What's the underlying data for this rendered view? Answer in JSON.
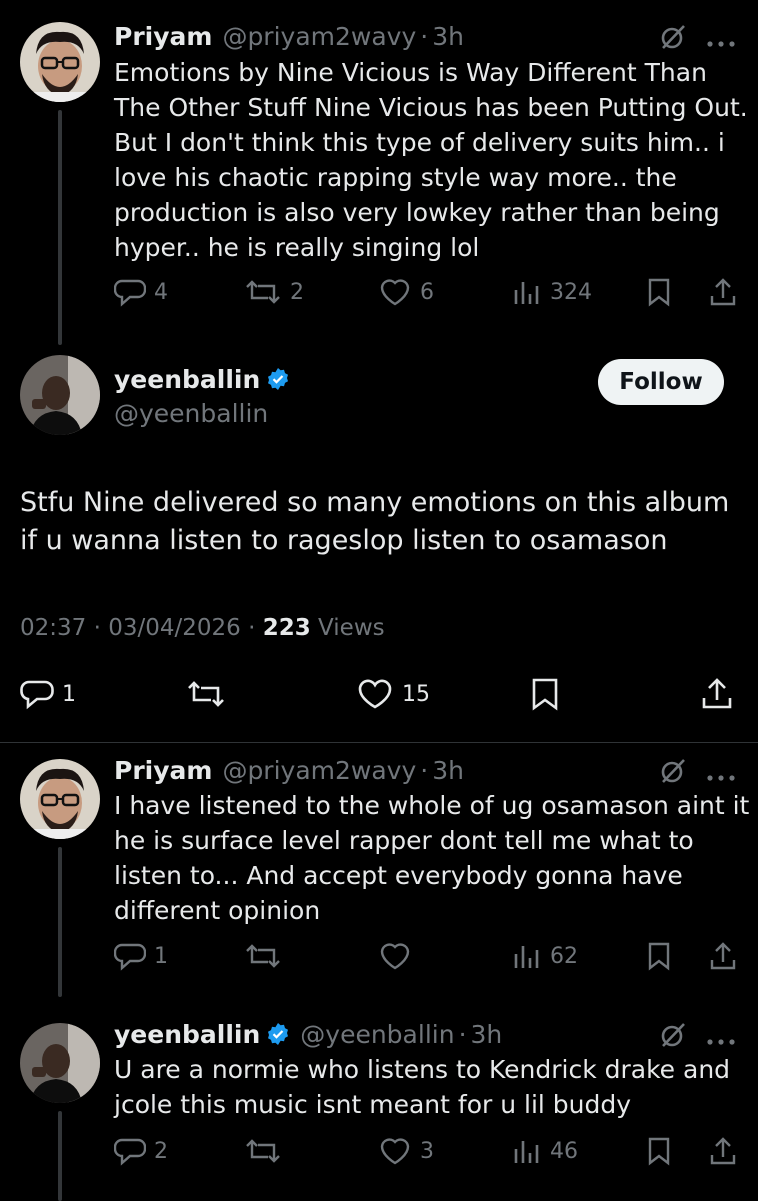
{
  "tweets": [
    {
      "name": "Priyam",
      "handle": "@priyam2wavy",
      "time": "3h",
      "text": "Emotions by Nine Vicious is Way Different Than\nThe Other Stuff Nine Vicious has been Putting Out.\nBut I don't think this type of delivery suits him.. i\nlove his chaotic rapping style way more.. the\nproduction is also very lowkey rather than being\nhyper.. he is really singing lol",
      "replies": "4",
      "reposts": "2",
      "likes": "6",
      "views": "324"
    },
    {
      "name": "yeenballin",
      "handle": "@yeenballin",
      "follow_label": "Follow",
      "text": "Stfu Nine delivered so many emotions on this album\nif u wanna listen to rageslop listen to osamason",
      "timestamp": "02:37 · 03/04/2026 · ",
      "views_count": "223",
      "views_label": " Views",
      "replies": "1",
      "likes": "15"
    },
    {
      "name": "Priyam",
      "handle": "@priyam2wavy",
      "time": "3h",
      "text": "I have listened to the whole of ug osamason aint it\nhe is  surface level rapper dont tell me what to\nlisten to... And accept everybody gonna have\ndifferent opinion",
      "replies": "1",
      "views": "62"
    },
    {
      "name": "yeenballin",
      "handle": "@yeenballin",
      "time": "3h",
      "text": "U are a normie who listens to Kendrick drake and\njcole this music isnt meant for u lil buddy",
      "replies": "2",
      "likes": "3",
      "views": "46"
    }
  ],
  "separator": "·",
  "colors": {
    "background": "#000000",
    "text": "#e7e9ea",
    "muted": "#71767b",
    "verified": "#1d9bf0",
    "follow_bg": "#eff3f4"
  },
  "icons": [
    "grok-icon",
    "more-icon",
    "reply-icon",
    "repost-icon",
    "like-icon",
    "views-icon",
    "bookmark-icon",
    "share-icon",
    "verified-badge-icon"
  ]
}
